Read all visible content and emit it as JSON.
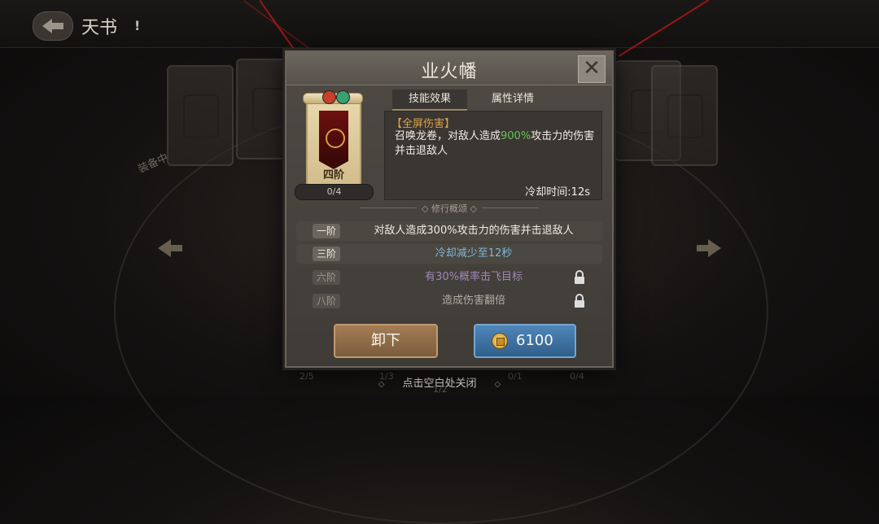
{
  "header": {
    "title": "天书",
    "info_icon": "!"
  },
  "background": {
    "prep_text": "装备中",
    "counters": [
      "2/5",
      "1/3",
      "0/1",
      "0/4"
    ],
    "bottom_hint": "点击空白处关闭",
    "bottom_counter": "1/2"
  },
  "dialog": {
    "title": "业火幡",
    "close_symbol": "✕",
    "item": {
      "tier": "四阶",
      "progress": "0/4",
      "element_colors": [
        "#c8402a",
        "#3aa070"
      ]
    },
    "tabs": [
      {
        "label": "技能效果",
        "active": true
      },
      {
        "label": "属性详情",
        "active": false
      }
    ],
    "effect": {
      "tag": "【全屏伤害】",
      "desc_before": "召唤龙卷，对敌人造成",
      "desc_highlight": "900%",
      "desc_after": "攻击力的伤害并击退敌人",
      "cooldown_label": "冷却时间:",
      "cooldown_value": "12s"
    },
    "progression": {
      "title": "修行概颂",
      "stages": [
        {
          "badge": "一阶",
          "text": "对敌人造成300%攻击力的伤害并击退敌人",
          "locked": false
        },
        {
          "badge": "三阶",
          "text": "冷却减少至12秒",
          "locked": false
        },
        {
          "badge": "六阶",
          "text": "有30%概率击飞目标",
          "locked": true
        },
        {
          "badge": "八阶",
          "text": "造成伤害翻倍",
          "locked": true
        }
      ]
    },
    "buttons": {
      "unequip_label": "卸下",
      "upgrade_cost": "6100"
    }
  }
}
